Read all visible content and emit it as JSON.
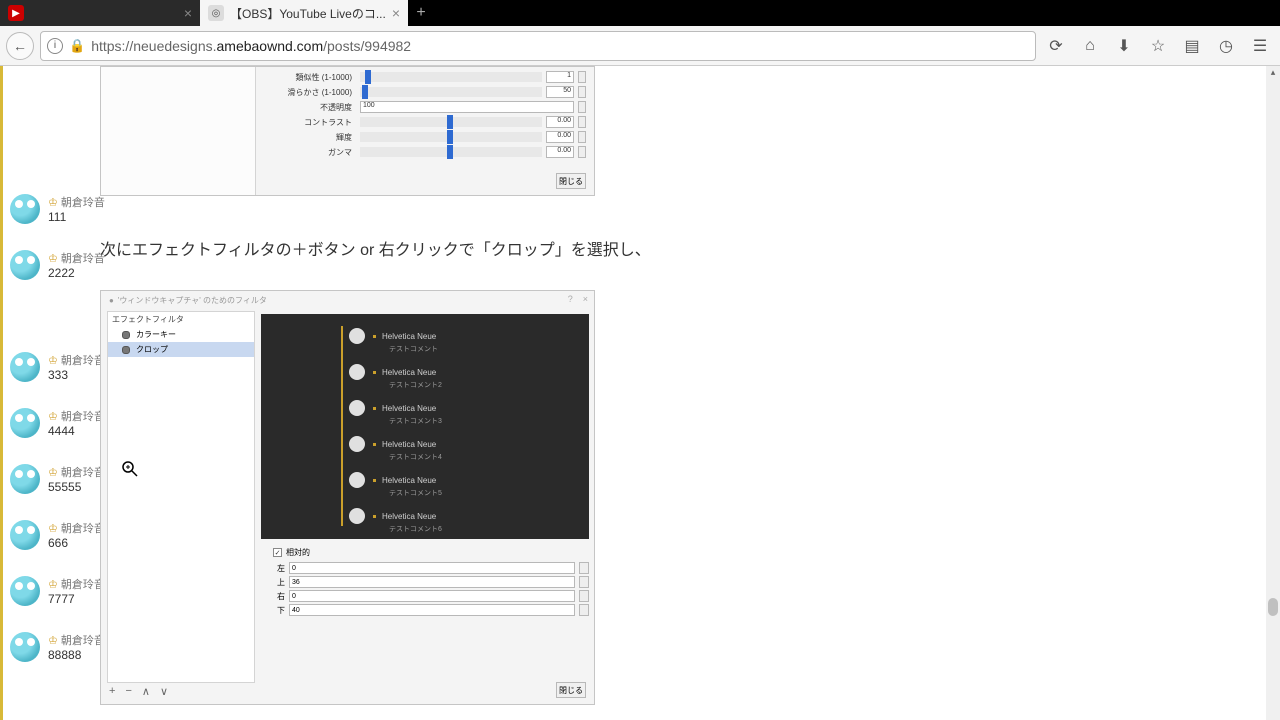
{
  "tabs": [
    {
      "label": "",
      "favicon": "yt",
      "active": false
    },
    {
      "label": "【OBS】YouTube Liveのコ...",
      "favicon": "ownd",
      "active": true
    }
  ],
  "url": {
    "prefix": "https://neuedesigns.",
    "host": "amebaownd.com",
    "path": "/posts/994982"
  },
  "chat": {
    "author": "朝倉玲音",
    "items": [
      {
        "msg": "111"
      },
      {
        "msg": "2222"
      },
      {
        "msg": "333"
      },
      {
        "msg": "4444"
      },
      {
        "msg": "55555"
      },
      {
        "msg": "666"
      },
      {
        "msg": "7777"
      },
      {
        "msg": "88888"
      }
    ]
  },
  "panel1": {
    "sliders": [
      {
        "label": "類似性 (1-1000)",
        "pos": 3,
        "val": "1"
      },
      {
        "label": "滑らかさ (1-1000)",
        "pos": 1,
        "val": "50"
      },
      {
        "label": "不透明度",
        "pos": 0,
        "val": "100",
        "wide": true
      },
      {
        "label": "コントラスト",
        "pos": 48,
        "val": "0.00"
      },
      {
        "label": "輝度",
        "pos": 48,
        "val": "0.00"
      },
      {
        "label": "ガンマ",
        "pos": 48,
        "val": "0.00"
      }
    ],
    "close": "閉じる"
  },
  "article_text": "次にエフェクトフィルタの＋ボタン or 右クリックで「クロップ」を選択し、",
  "panel2": {
    "title": "'ウィンドウキャプチャ' のためのフィルタ",
    "sidebar_header": "エフェクトフィルタ",
    "filters": [
      {
        "name": "カラーキー",
        "selected": false
      },
      {
        "name": "クロップ",
        "selected": true
      }
    ],
    "preview_rows": [
      {
        "name": "Helvetica Neue",
        "sub": "テストコメント"
      },
      {
        "name": "Helvetica Neue",
        "sub": "テストコメント2"
      },
      {
        "name": "Helvetica Neue",
        "sub": "テストコメント3"
      },
      {
        "name": "Helvetica Neue",
        "sub": "テストコメント4"
      },
      {
        "name": "Helvetica Neue",
        "sub": "テストコメント5"
      },
      {
        "name": "Helvetica Neue",
        "sub": "テストコメント6"
      }
    ],
    "crop": {
      "relative_label": "相対的",
      "fields": [
        {
          "label": "左",
          "val": "0"
        },
        {
          "label": "上",
          "val": "36"
        },
        {
          "label": "右",
          "val": "0"
        },
        {
          "label": "下",
          "val": "40"
        }
      ]
    },
    "close": "閉じる",
    "toolbar_icons": [
      "+",
      "−",
      "∧",
      "∨"
    ]
  }
}
